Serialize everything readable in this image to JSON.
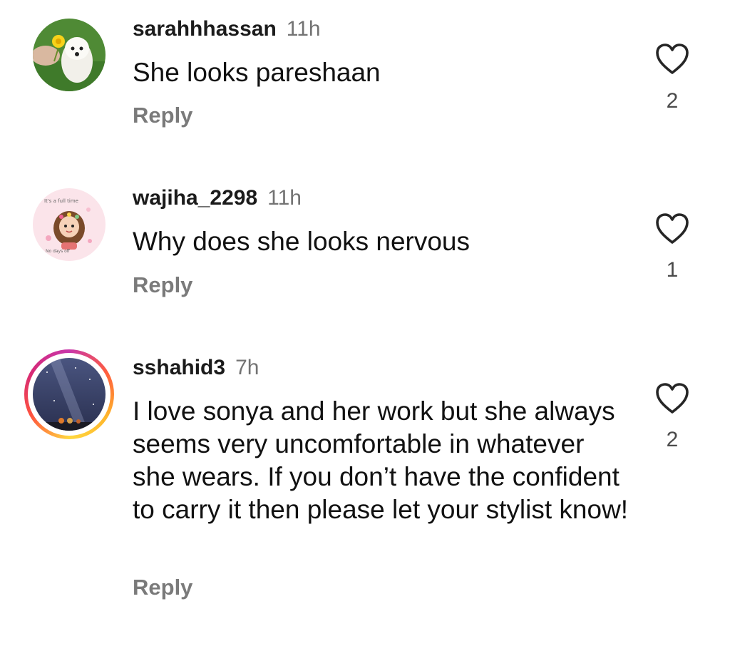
{
  "comments": [
    {
      "username": "sarahhhassan",
      "time": "11h",
      "text": "She looks pareshaan",
      "reply": "Reply",
      "likes": "2",
      "like_icon": "heart-outline-icon",
      "has_story_ring": false
    },
    {
      "username": "wajiha_2298",
      "time": "11h",
      "text": "Why does she looks nervous",
      "reply": "Reply",
      "likes": "1",
      "like_icon": "heart-outline-icon",
      "has_story_ring": false
    },
    {
      "username": "sshahid3",
      "time": "7h",
      "text": "I love sonya and her work but she always seems very uncomfortable in whatever she wears. If you don’t have the confident to carry it then please let your stylist know!",
      "reply": "Reply",
      "likes": "2",
      "like_icon": "heart-outline-icon",
      "has_story_ring": true
    }
  ],
  "colors": {
    "username": "#1b1b1b",
    "time": "#737373",
    "reply": "#7a7a7a",
    "story_ring": [
      "#c837ab",
      "#ff5d3d",
      "#ffb52b",
      "#ffd83f"
    ]
  }
}
